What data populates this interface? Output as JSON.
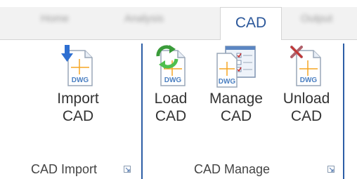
{
  "tabs": [
    {
      "label": "Home",
      "active": false
    },
    {
      "label": "Analysis",
      "active": false
    },
    {
      "label": "CAD",
      "active": true
    },
    {
      "label": "Output",
      "active": false
    }
  ],
  "groups": [
    {
      "label": "CAD Import",
      "buttons": [
        {
          "line1": "Import",
          "line2": "CAD",
          "icon": "import-dwg-icon"
        }
      ]
    },
    {
      "label": "CAD Manage",
      "buttons": [
        {
          "line1": "Load",
          "line2": "CAD",
          "icon": "load-dwg-icon"
        },
        {
          "line1": "Manage",
          "line2": "CAD",
          "icon": "manage-dwg-icon"
        },
        {
          "line1": "Unload",
          "line2": "CAD",
          "icon": "unload-dwg-icon"
        }
      ]
    }
  ],
  "icon_text": "DWG",
  "colors": {
    "accent": "#2b579a",
    "divider": "#2d5ea6",
    "dwg_text": "#4a7fc1",
    "crosshair": "#f5a623"
  }
}
